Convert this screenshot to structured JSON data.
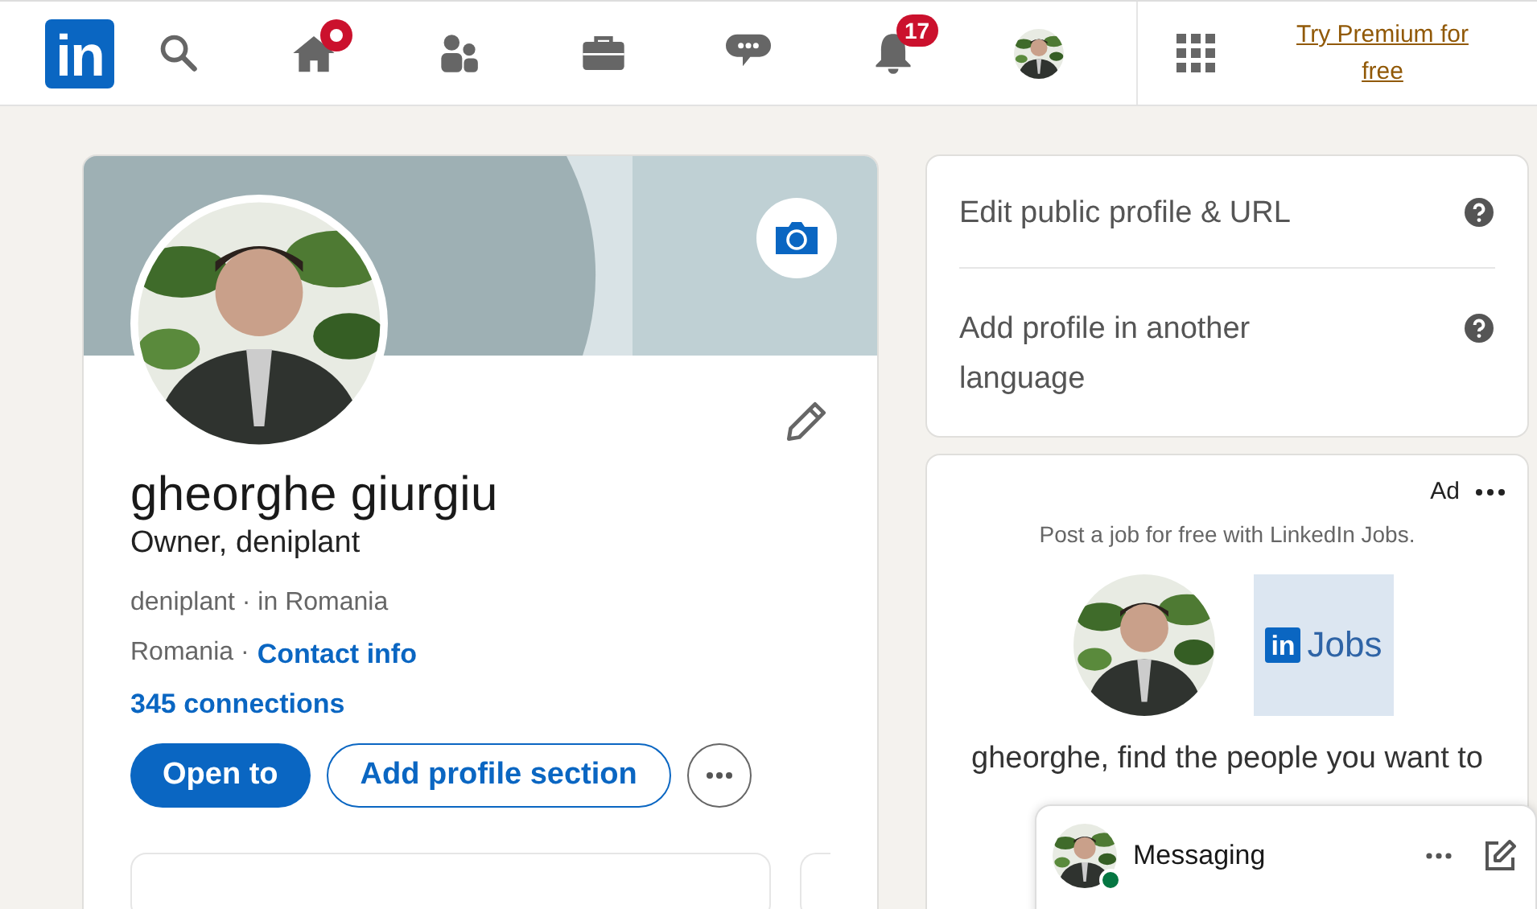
{
  "nav": {
    "logo": "in",
    "home_unread": true,
    "notifications_count": "17",
    "premium_link": "Try Premium for free"
  },
  "profile": {
    "name": "gheorghe giurgiu",
    "headline": "Owner, deniplant",
    "company_line": "deniplant · in Romania",
    "location": "Romania ·",
    "contact_link": "Contact info",
    "connections": "345 connections",
    "primary_button": "Open to",
    "secondary_button": "Add profile section"
  },
  "help_items": [
    {
      "label": "Edit public profile & URL"
    },
    {
      "label": "Add profile in another language"
    }
  ],
  "ad": {
    "label": "Ad",
    "intro": "Post a job for free with LinkedIn Jobs.",
    "logo_badge": "in",
    "logo_text": "Jobs",
    "headline": "gheorghe, find the people you want to"
  },
  "messaging": {
    "label": "Messaging",
    "online": true
  }
}
